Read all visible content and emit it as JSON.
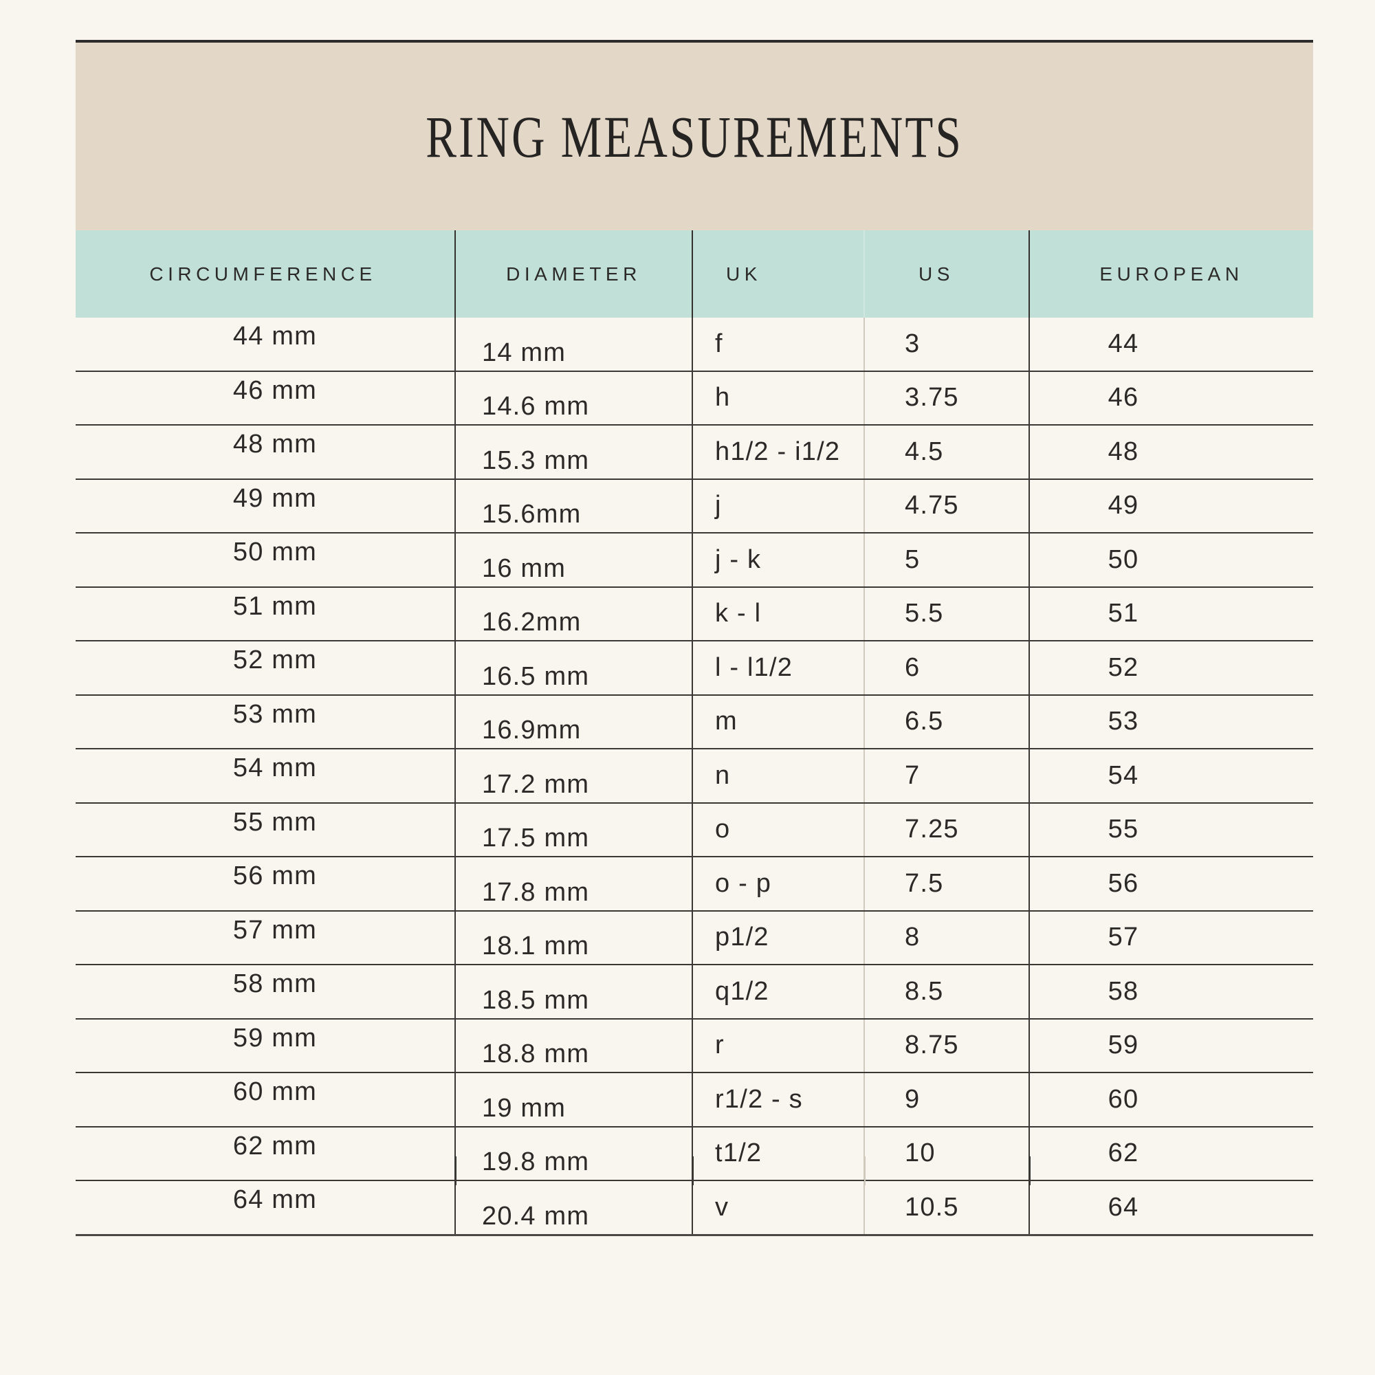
{
  "page": {
    "background_color": "#f9f6ef",
    "title_band_color": "#e3d7c8",
    "header_row_color": "#c0e0d8",
    "text_color": "#2b2a28",
    "rule_color": "#3a3835"
  },
  "title": "RING MEASUREMENTS",
  "table": {
    "columns": [
      {
        "key": "circumference",
        "label": "CIRCUMFERENCE"
      },
      {
        "key": "diameter",
        "label": "DIAMETER"
      },
      {
        "key": "uk",
        "label": "UK"
      },
      {
        "key": "us",
        "label": "US"
      },
      {
        "key": "european",
        "label": "EUROPEAN"
      }
    ],
    "rows": [
      {
        "circumference": "44 mm",
        "diameter": "14 mm",
        "uk": "f",
        "us": "3",
        "european": "44"
      },
      {
        "circumference": "46 mm",
        "diameter": "14.6 mm",
        "uk": "h",
        "us": "3.75",
        "european": "46"
      },
      {
        "circumference": "48 mm",
        "diameter": "15.3 mm",
        "uk": "h1/2 - i1/2",
        "us": "4.5",
        "european": "48"
      },
      {
        "circumference": "49 mm",
        "diameter": "15.6mm",
        "uk": "j",
        "us": "4.75",
        "european": "49"
      },
      {
        "circumference": "50 mm",
        "diameter": "16 mm",
        "uk": "j - k",
        "us": "5",
        "european": "50"
      },
      {
        "circumference": "51 mm",
        "diameter": "16.2mm",
        "uk": "k - l",
        "us": "5.5",
        "european": "51"
      },
      {
        "circumference": "52 mm",
        "diameter": "16.5 mm",
        "uk": "l - l1/2",
        "us": "6",
        "european": "52"
      },
      {
        "circumference": "53 mm",
        "diameter": "16.9mm",
        "uk": "m",
        "us": "6.5",
        "european": "53"
      },
      {
        "circumference": "54 mm",
        "diameter": "17.2 mm",
        "uk": "n",
        "us": "7",
        "european": "54"
      },
      {
        "circumference": "55 mm",
        "diameter": "17.5 mm",
        "uk": "o",
        "us": "7.25",
        "european": "55"
      },
      {
        "circumference": "56 mm",
        "diameter": "17.8 mm",
        "uk": "o - p",
        "us": "7.5",
        "european": "56"
      },
      {
        "circumference": "57 mm",
        "diameter": "18.1 mm",
        "uk": "p1/2",
        "us": "8",
        "european": "57"
      },
      {
        "circumference": "58 mm",
        "diameter": "18.5 mm",
        "uk": "q1/2",
        "us": "8.5",
        "european": "58"
      },
      {
        "circumference": "59 mm",
        "diameter": "18.8 mm",
        "uk": "r",
        "us": "8.75",
        "european": "59"
      },
      {
        "circumference": "60 mm",
        "diameter": "19 mm",
        "uk": "r1/2 - s",
        "us": "9",
        "european": "60"
      },
      {
        "circumference": "62 mm",
        "diameter": "19.8 mm",
        "uk": "t1/2",
        "us": "10",
        "european": "62"
      },
      {
        "circumference": "64 mm",
        "diameter": "20.4 mm",
        "uk": "v",
        "us": "10.5",
        "european": "64"
      }
    ]
  }
}
